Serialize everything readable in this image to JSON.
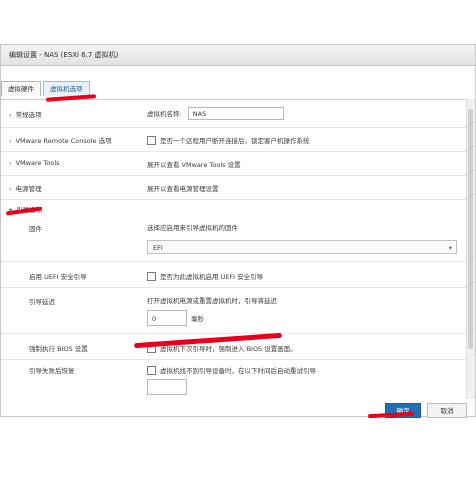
{
  "window": {
    "title": "编辑设置 - NAS (ESXi 6.7 虚拟机)"
  },
  "tabs": [
    {
      "label": "虚拟硬件",
      "active": false
    },
    {
      "label": "虚拟机选项",
      "active": true
    }
  ],
  "rows": {
    "general": {
      "label": "常规选项",
      "name_label": "虚拟机名称:",
      "name_value": "NAS"
    },
    "vmrc": {
      "label": "VMware Remote Console 选项",
      "desc": "是否一个远程用户断开连接后，锁定客户机操作系统"
    },
    "tools": {
      "label": "VMware Tools",
      "desc": "展开以查看 VMware Tools 设置"
    },
    "power": {
      "label": "电源管理",
      "desc": "展开以查看电源管理设置"
    },
    "boot": {
      "label": "引导选项"
    },
    "firmware": {
      "label": "固件",
      "desc": "选择应启用来引导虚拟机的固件",
      "value": "EFI"
    },
    "uefi": {
      "label": "启用 UEFI 安全引导",
      "desc": "是否为此虚拟机启用 UEFI 安全引导",
      "checked": false
    },
    "delay": {
      "label": "引导延迟",
      "desc": "打开虚拟机电源或重置虚拟机时，引导将延迟",
      "value": "0",
      "unit": "毫秒"
    },
    "bios": {
      "label": "强制执行 BIOS 设置",
      "desc": "虚拟机下次引导时，强制进入 BIOS 设置画面。",
      "checked": true
    },
    "recovery": {
      "label": "引导失败后恢复",
      "desc": "虚拟机找不到引导设备时，在以下时间后自动重试引导",
      "checked": false
    }
  },
  "footer": {
    "ok_label": "确定",
    "cancel_label": "取消"
  },
  "colors": {
    "accent": "#1f6fb2",
    "annotation": "#e8001b"
  }
}
